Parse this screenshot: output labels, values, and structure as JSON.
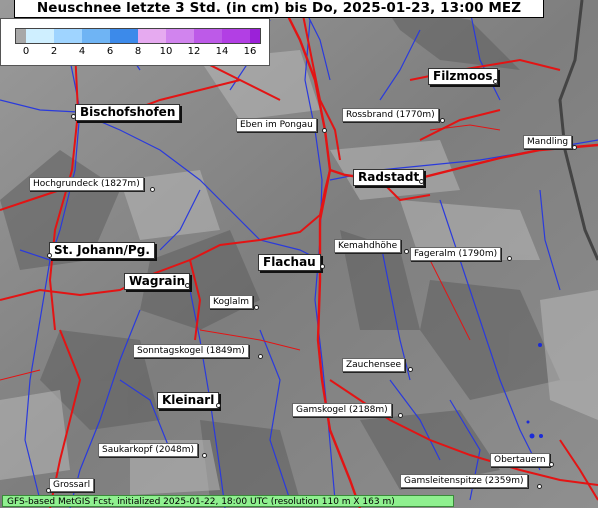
{
  "title": "Neuschnee letzte 3 Std. (in cm) bis Do, 2025-01-23, 13:00 MEZ",
  "legend": {
    "labels": [
      "0",
      "2",
      "4",
      "6",
      "8",
      "10",
      "12",
      "14",
      "16"
    ],
    "colors": [
      "#a8a8a8",
      "#cfefff",
      "#9fd4ff",
      "#6fb4f4",
      "#3c8aea",
      "#1c5fd8",
      "#e6aaf0",
      "#d184ee",
      "#bd5ae8",
      "#9b21d8"
    ]
  },
  "places": {
    "filzmoos": "Filzmoos",
    "bischofshofen": "Bischofshofen",
    "eben": "Eben im Pongau",
    "rossbrand": "Rossbrand (1770m)",
    "mandling": "Mandling",
    "radstadt": "Radstadt",
    "hochgrundeck": "Hochgrundeck (1827m)",
    "kemahdhoehe": "Kemahdhöhe",
    "fageralm": "Fageralm (1790m)",
    "stjohann": "St. Johann/Pg.",
    "flachau": "Flachau",
    "wagrain": "Wagrain",
    "koglalm": "Koglalm",
    "sonntagskogel": "Sonntagskogel (1849m)",
    "zauchensee": "Zauchensee",
    "kleinarl": "Kleinarl",
    "gamskogel": "Gamskogel (2188m)",
    "saukarkopf": "Saukarkopf (2048m)",
    "obertauern": "Obertauern",
    "gamsleitenspitze": "Gamsleitenspitze (2359m)",
    "grossarl": "Grossarl"
  },
  "footer": "GFS-based MetGIS Fcst, initialized 2025-01-22, 18:00 UTC  (resolution 110 m X 163 m)"
}
